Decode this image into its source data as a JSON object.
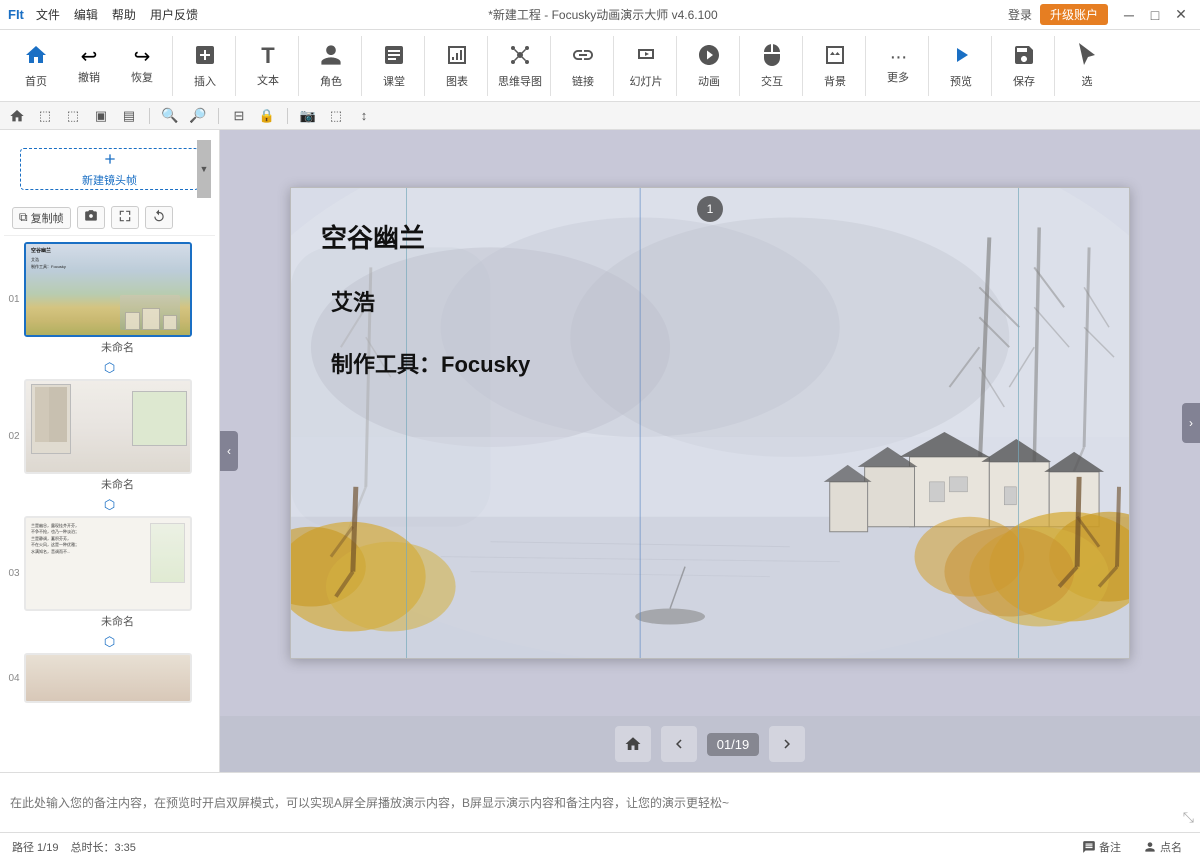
{
  "titlebar": {
    "logo": "FIt",
    "menus": [
      "文件",
      "编辑",
      "帮助",
      "用户反馈"
    ],
    "title": "*新建工程 - Focusky动画演示大师 v4.6.100",
    "login": "登录",
    "upgrade": "升级账户",
    "win_min": "─",
    "win_max": "□",
    "win_close": "✕"
  },
  "toolbar": {
    "groups": [
      {
        "items": [
          {
            "id": "home",
            "icon": "🏠",
            "label": "首页"
          },
          {
            "id": "undo",
            "icon": "↩",
            "label": "撤销"
          },
          {
            "id": "redo",
            "icon": "↪",
            "label": "恢复"
          }
        ]
      },
      {
        "items": [
          {
            "id": "insert",
            "icon": "➕",
            "label": "插入"
          }
        ]
      },
      {
        "items": [
          {
            "id": "text",
            "icon": "T",
            "label": "文本"
          }
        ]
      },
      {
        "items": [
          {
            "id": "role",
            "icon": "👤",
            "label": "角色"
          }
        ]
      },
      {
        "items": [
          {
            "id": "lesson",
            "icon": "📚",
            "label": "课堂"
          }
        ]
      },
      {
        "items": [
          {
            "id": "chart",
            "icon": "📊",
            "label": "图表"
          }
        ]
      },
      {
        "items": [
          {
            "id": "mindmap",
            "icon": "🔗",
            "label": "思维导图"
          }
        ]
      },
      {
        "items": [
          {
            "id": "link",
            "icon": "🔗",
            "label": "链接"
          }
        ]
      },
      {
        "items": [
          {
            "id": "slideshow",
            "icon": "🎞",
            "label": "幻灯片"
          }
        ]
      },
      {
        "items": [
          {
            "id": "animation",
            "icon": "🎬",
            "label": "动画"
          }
        ]
      },
      {
        "items": [
          {
            "id": "interact",
            "icon": "🖱",
            "label": "交互"
          }
        ]
      },
      {
        "items": [
          {
            "id": "background",
            "icon": "🖼",
            "label": "背景"
          }
        ]
      },
      {
        "items": [
          {
            "id": "more",
            "icon": "⋯",
            "label": "更多"
          }
        ]
      },
      {
        "items": [
          {
            "id": "preview",
            "icon": "▶",
            "label": "预览"
          }
        ]
      },
      {
        "items": [
          {
            "id": "save",
            "icon": "💾",
            "label": "保存"
          }
        ]
      },
      {
        "items": [
          {
            "id": "select",
            "icon": "↖",
            "label": "选"
          }
        ]
      }
    ]
  },
  "slide_panel": {
    "new_frame_label": "新建镜头帧",
    "copy_btn": "复制帧",
    "camera_btn": "",
    "fit_btn": "",
    "rotate_btn": "",
    "slides": [
      {
        "num": "01",
        "label": "未命名",
        "active": true
      },
      {
        "num": "02",
        "label": "未命名",
        "active": false
      },
      {
        "num": "03",
        "label": "未命名",
        "active": false
      },
      {
        "num": "04",
        "label": "",
        "active": false
      }
    ]
  },
  "canvas": {
    "frame_badge": "1",
    "title": "空谷幽兰",
    "subtitle": "艾浩",
    "tool_text": "制作工具：Focusky"
  },
  "bottom_nav": {
    "prev": "‹",
    "counter": "01/19",
    "next": "›",
    "home": "🏠"
  },
  "notes": {
    "placeholder": "在此处输入您的备注内容，在预览时开启双屏模式，可以实现A屏全屏播放演示内容，B屏显示演示内容和备注内容，让您的演示更轻松~"
  },
  "statusbar": {
    "position": "路径 1/19",
    "duration": "总时长：3:35",
    "notes_btn": "备注",
    "mark_btn": "点名"
  }
}
